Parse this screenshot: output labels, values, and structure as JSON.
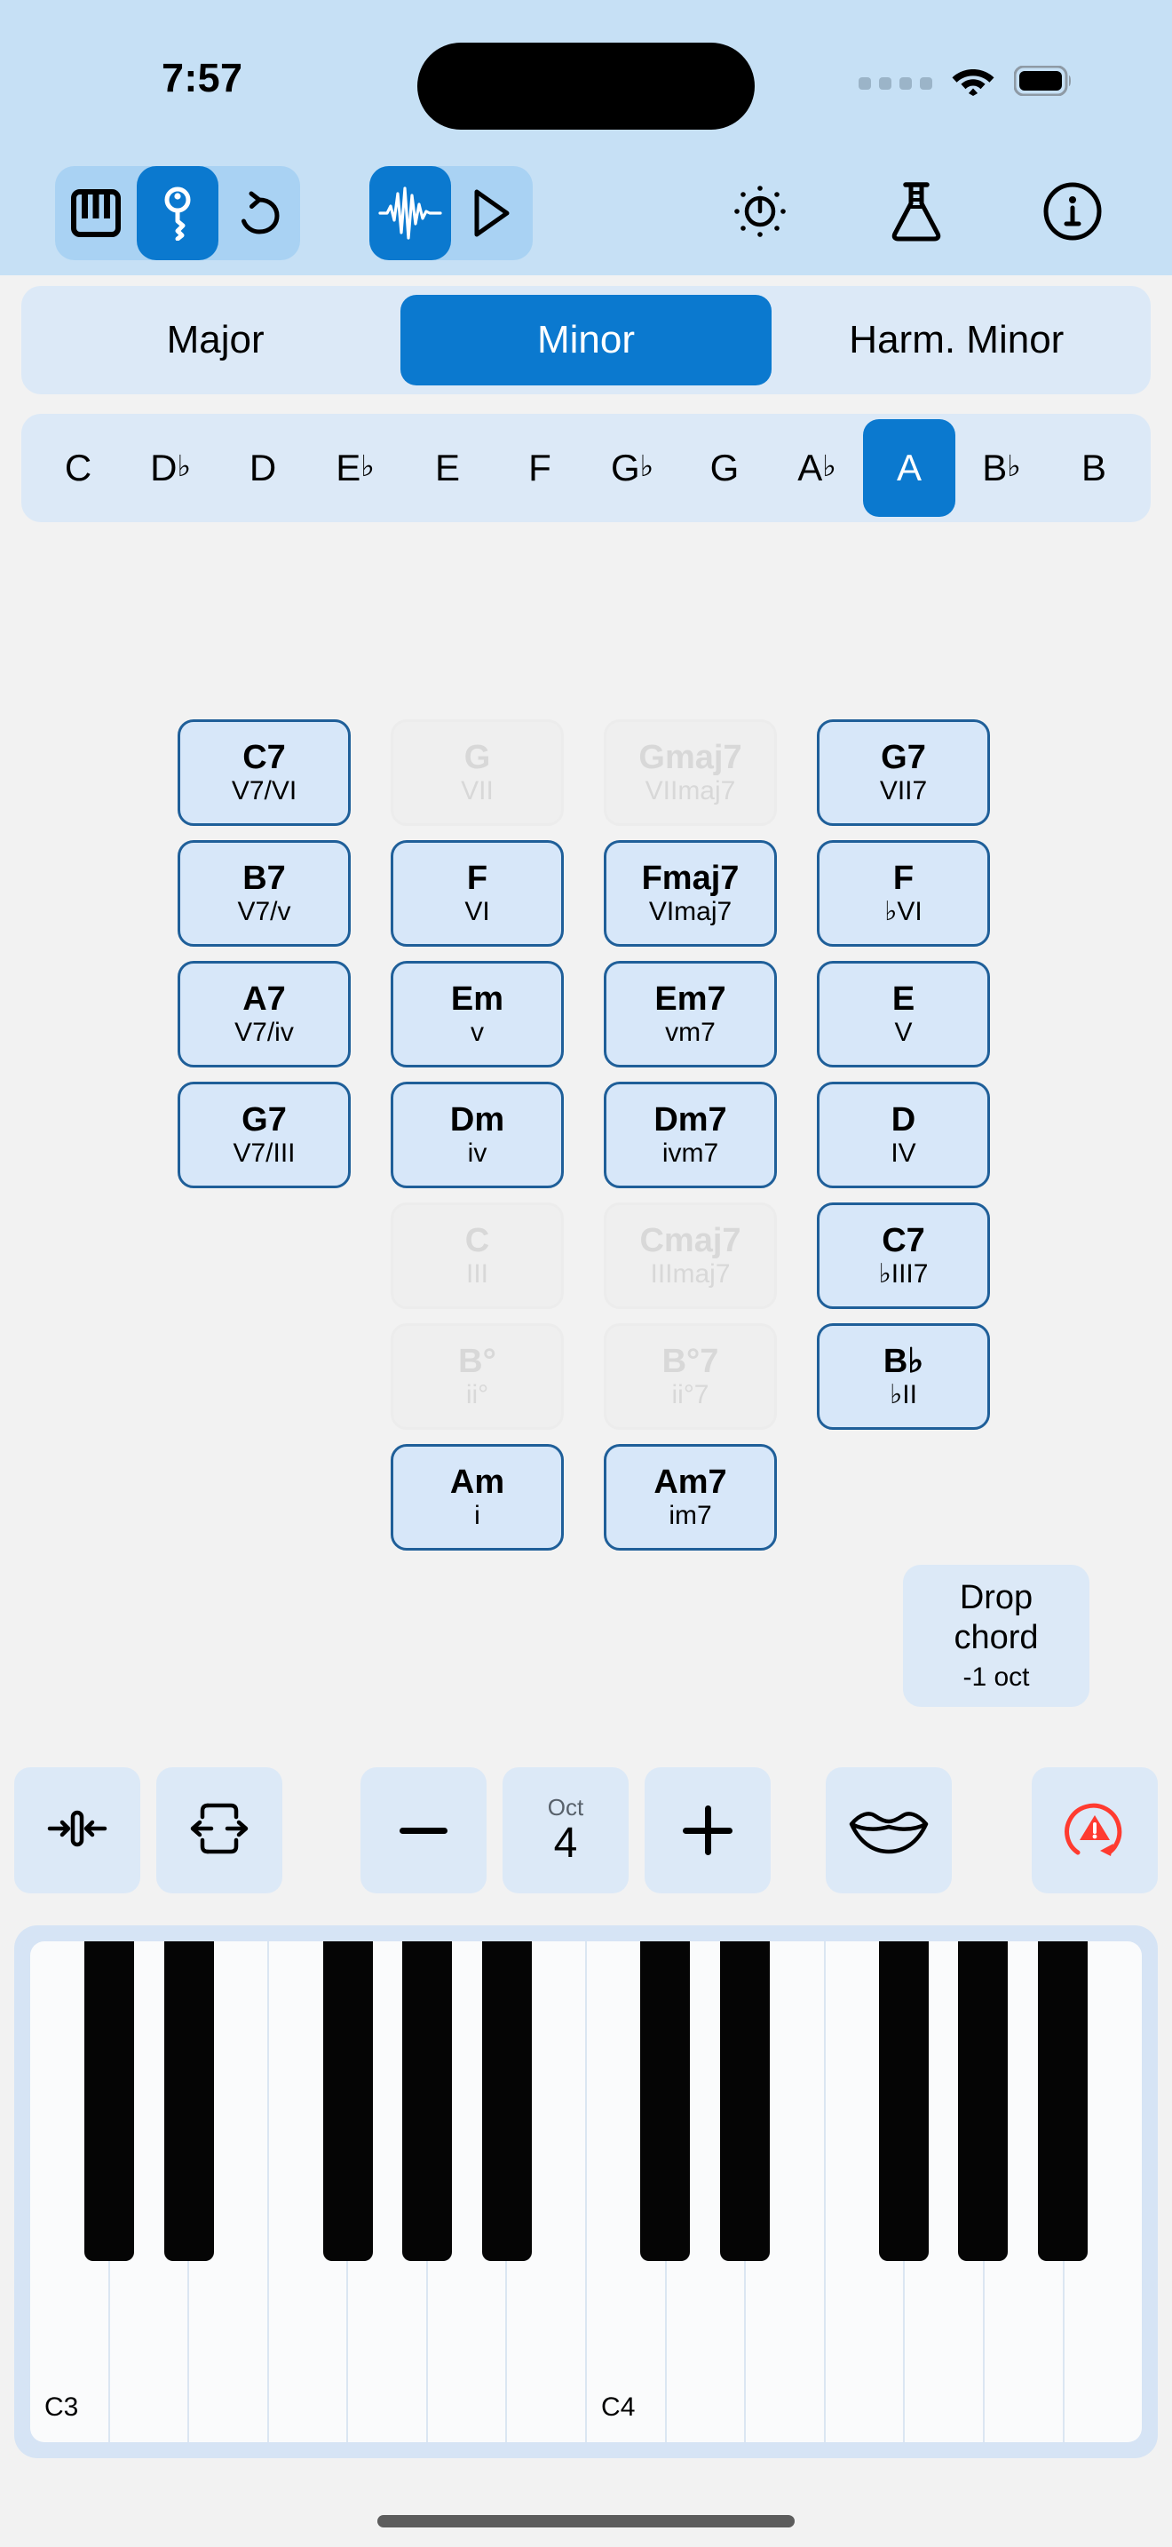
{
  "status_bar": {
    "time": "7:57",
    "icons": [
      "cellular-dots-icon",
      "wifi-icon",
      "battery-icon"
    ]
  },
  "toolbar": {
    "groups": [
      {
        "name": "instrument-group",
        "buttons": [
          {
            "name": "piano-keys-icon",
            "label": "Piano",
            "active": false
          },
          {
            "name": "key-icon",
            "label": "Key",
            "active": true
          },
          {
            "name": "undo-icon",
            "label": "Undo",
            "active": false
          }
        ]
      },
      {
        "name": "playback-group",
        "buttons": [
          {
            "name": "waveform-icon",
            "label": "Waveform",
            "active": true
          },
          {
            "name": "play-icon",
            "label": "Play",
            "active": false
          }
        ]
      }
    ],
    "right_buttons": [
      {
        "name": "metronome-icon",
        "label": "Metronome"
      },
      {
        "name": "flask-icon",
        "label": "Experiments"
      },
      {
        "name": "info-icon",
        "label": "Info"
      }
    ]
  },
  "scale_selector": {
    "options": [
      "Major",
      "Minor",
      "Harm. Minor"
    ],
    "selected": "Minor"
  },
  "key_selector": {
    "keys": [
      {
        "letter": "C",
        "accidental": ""
      },
      {
        "letter": "D",
        "accidental": "♭"
      },
      {
        "letter": "D",
        "accidental": ""
      },
      {
        "letter": "E",
        "accidental": "♭"
      },
      {
        "letter": "E",
        "accidental": ""
      },
      {
        "letter": "F",
        "accidental": ""
      },
      {
        "letter": "G",
        "accidental": "♭"
      },
      {
        "letter": "G",
        "accidental": ""
      },
      {
        "letter": "A",
        "accidental": "♭"
      },
      {
        "letter": "A",
        "accidental": ""
      },
      {
        "letter": "B",
        "accidental": "♭"
      },
      {
        "letter": "B",
        "accidental": ""
      }
    ],
    "selected": "A"
  },
  "chord_grid": {
    "columns": 4,
    "cells": [
      {
        "name": "C7",
        "degree": "V7/VI",
        "state": "enabled"
      },
      {
        "name": "G",
        "degree": "VII",
        "state": "disabled"
      },
      {
        "name": "Gmaj7",
        "degree": "VIImaj7",
        "state": "disabled"
      },
      {
        "name": "G7",
        "degree": "VII7",
        "state": "enabled"
      },
      {
        "name": "B7",
        "degree": "V7/v",
        "state": "enabled"
      },
      {
        "name": "F",
        "degree": "VI",
        "state": "enabled"
      },
      {
        "name": "Fmaj7",
        "degree": "VImaj7",
        "state": "enabled"
      },
      {
        "name": "F",
        "degree": "♭VI",
        "state": "enabled"
      },
      {
        "name": "A7",
        "degree": "V7/iv",
        "state": "enabled"
      },
      {
        "name": "Em",
        "degree": "v",
        "state": "enabled"
      },
      {
        "name": "Em7",
        "degree": "vm7",
        "state": "enabled"
      },
      {
        "name": "E",
        "degree": "V",
        "state": "enabled"
      },
      {
        "name": "G7",
        "degree": "V7/III",
        "state": "enabled"
      },
      {
        "name": "Dm",
        "degree": "iv",
        "state": "enabled"
      },
      {
        "name": "Dm7",
        "degree": "ivm7",
        "state": "enabled"
      },
      {
        "name": "D",
        "degree": "IV",
        "state": "enabled"
      },
      {
        "name": "",
        "degree": "",
        "state": "empty"
      },
      {
        "name": "C",
        "degree": "III",
        "state": "disabled"
      },
      {
        "name": "Cmaj7",
        "degree": "IIImaj7",
        "state": "disabled"
      },
      {
        "name": "C7",
        "degree": "♭III7",
        "state": "enabled"
      },
      {
        "name": "",
        "degree": "",
        "state": "empty"
      },
      {
        "name": "B°",
        "degree": "ii°",
        "state": "disabled"
      },
      {
        "name": "B°7",
        "degree": "ii°7",
        "state": "disabled"
      },
      {
        "name": "B♭",
        "degree": "♭II",
        "state": "enabled"
      },
      {
        "name": "",
        "degree": "",
        "state": "empty"
      },
      {
        "name": "Am",
        "degree": "i",
        "state": "enabled"
      },
      {
        "name": "Am7",
        "degree": "im7",
        "state": "enabled"
      },
      {
        "name": "",
        "degree": "",
        "state": "empty"
      }
    ]
  },
  "drop_chord": {
    "line1": "Drop",
    "line2": "chord",
    "line3": "-1 oct"
  },
  "control_bar": {
    "buttons": [
      {
        "name": "collapse-icon",
        "label": "Narrow"
      },
      {
        "name": "expand-icon",
        "label": "Expand"
      },
      {
        "name": "minus-button",
        "label": "−"
      },
      {
        "name": "octave-stepper",
        "label": "Oct",
        "value": "4"
      },
      {
        "name": "plus-button",
        "label": "+"
      },
      {
        "name": "lips-icon",
        "label": "Vocal"
      },
      {
        "name": "panic-icon",
        "label": "Panic"
      }
    ],
    "octave_label": "Oct",
    "octave_value": "4",
    "panic_color": "#ff3b30"
  },
  "piano": {
    "white_key_count": 14,
    "labels": {
      "first": "C3",
      "eighth": "C4"
    },
    "black_key_pattern": [
      1,
      1,
      0,
      1,
      1,
      1,
      0
    ]
  },
  "colors": {
    "accent": "#0b79cf",
    "status_bg": "#c6e0f5",
    "panel_bg": "#dce9f7",
    "chord_fill": "#d7e7f9",
    "chord_border": "#1f5f99",
    "page_bg": "#f2f2f2",
    "panic_red": "#ff3b30"
  }
}
